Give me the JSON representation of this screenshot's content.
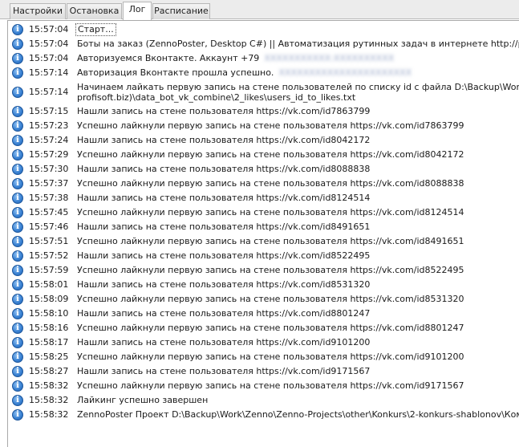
{
  "tabs": [
    {
      "label": "Настройки"
    },
    {
      "label": "Остановка"
    },
    {
      "label": "Лог"
    },
    {
      "label": "Расписание"
    }
  ],
  "active_tab": "Лог",
  "log": [
    {
      "time": "15:57:04",
      "text": "Старт..."
    },
    {
      "time": "15:57:04",
      "text": "Боты на заказ (ZennoPoster, Desktop C#) || Автоматизация рутинных задач в интернете http://profisoft.biz"
    },
    {
      "time": "15:57:04",
      "text": "Авторизуемся Вконтакте. Аккаунт +79",
      "hidden": "XXXXXXXXXXX:XXXXXXXXXX"
    },
    {
      "time": "15:57:14",
      "text": "Авторизация Вконтакте прошла успешно.",
      "hidden": "XXXXXXXXXXXXXXXXXXXXXX"
    },
    {
      "time": "15:57:14",
      "text": "Начинаем лайкать первую запись на стене пользователей по списку id с файла D:\\Backup\\Work\\Zenno\\Zenno",
      "text2": "profisoft.biz)\\data_bot_vk_combine\\2_likes\\users_id_to_likes.txt"
    },
    {
      "time": "15:57:15",
      "text": "Нашли запись на стене пользователя https://vk.com/id7863799"
    },
    {
      "time": "15:57:23",
      "text": "Успешно лайкнули первую запись на стене пользователя https://vk.com/id7863799"
    },
    {
      "time": "15:57:24",
      "text": "Нашли запись на стене пользователя https://vk.com/id8042172"
    },
    {
      "time": "15:57:29",
      "text": "Успешно лайкнули первую запись на стене пользователя https://vk.com/id8042172"
    },
    {
      "time": "15:57:30",
      "text": "Нашли запись на стене пользователя https://vk.com/id8088838"
    },
    {
      "time": "15:57:37",
      "text": "Успешно лайкнули первую запись на стене пользователя https://vk.com/id8088838"
    },
    {
      "time": "15:57:38",
      "text": "Нашли запись на стене пользователя https://vk.com/id8124514"
    },
    {
      "time": "15:57:45",
      "text": "Успешно лайкнули первую запись на стене пользователя https://vk.com/id8124514"
    },
    {
      "time": "15:57:46",
      "text": "Нашли запись на стене пользователя https://vk.com/id8491651"
    },
    {
      "time": "15:57:51",
      "text": "Успешно лайкнули первую запись на стене пользователя https://vk.com/id8491651"
    },
    {
      "time": "15:57:52",
      "text": "Нашли запись на стене пользователя https://vk.com/id8522495"
    },
    {
      "time": "15:57:59",
      "text": "Успешно лайкнули первую запись на стене пользователя https://vk.com/id8522495"
    },
    {
      "time": "15:58:01",
      "text": "Нашли запись на стене пользователя https://vk.com/id8531320"
    },
    {
      "time": "15:58:09",
      "text": "Успешно лайкнули первую запись на стене пользователя https://vk.com/id8531320"
    },
    {
      "time": "15:58:10",
      "text": "Нашли запись на стене пользователя https://vk.com/id8801247"
    },
    {
      "time": "15:58:16",
      "text": "Успешно лайкнули первую запись на стене пользователя https://vk.com/id8801247"
    },
    {
      "time": "15:58:17",
      "text": "Нашли запись на стене пользователя https://vk.com/id9101200"
    },
    {
      "time": "15:58:25",
      "text": "Успешно лайкнули первую запись на стене пользователя https://vk.com/id9101200"
    },
    {
      "time": "15:58:27",
      "text": "Нашли запись на стене пользователя https://vk.com/id9171567"
    },
    {
      "time": "15:58:32",
      "text": "Успешно лайкнули первую запись на стене пользователя https://vk.com/id9171567"
    },
    {
      "time": "15:58:32",
      "text": "Лайкинг успешно завершен"
    },
    {
      "time": "15:58:32",
      "text": "ZennoPoster Проект D:\\Backup\\Work\\Zenno\\Zenno-Projects\\other\\Konkurs\\2-konkurs-shablonov\\Комбайн для Вк"
    }
  ],
  "icon": "info-icon",
  "colors": {
    "icon": "#3b83d4",
    "tab_bg": "#dcdcdc",
    "panel_border": "#a9a9a9"
  }
}
